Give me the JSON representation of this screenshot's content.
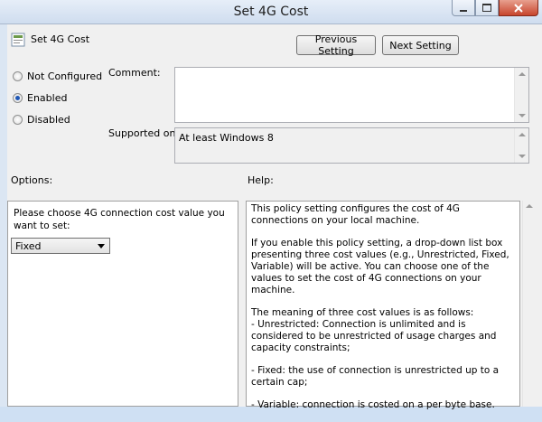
{
  "window": {
    "title": "Set 4G Cost"
  },
  "header": {
    "policy_name": "Set 4G Cost"
  },
  "nav": {
    "previous_label": "Previous Setting",
    "next_label": "Next Setting"
  },
  "state": {
    "options": [
      "Not Configured",
      "Enabled",
      "Disabled"
    ],
    "selected": "Enabled"
  },
  "comment": {
    "label": "Comment:",
    "value": ""
  },
  "supported": {
    "label": "Supported on:",
    "value": "At least Windows 8"
  },
  "options_section": {
    "label": "Options:",
    "prompt": "Please choose 4G connection cost value you want to set:",
    "dropdown_value": "Fixed"
  },
  "help_section": {
    "label": "Help:",
    "paragraphs": [
      "This policy setting configures the cost of 4G connections on your local machine.",
      "If you enable this policy setting, a drop-down list box presenting three cost values (e.g., Unrestricted, Fixed, Variable) will be active. You can choose one of the values to set the cost of 4G connections on your machine.",
      "The meaning of three cost values is as follows:\n- Unrestricted: Connection is unlimited and is considered to be unrestricted of usage charges and capacity constraints;",
      "- Fixed: the use of connection is unrestricted up to a certain cap;",
      "- Variable: connection is costed on a per byte base."
    ]
  },
  "colors": {
    "title_bg": "#dbe6f3",
    "client_bg": "#f0f0f0",
    "close_button": "#c7452c",
    "radio_dot": "#1f57b5"
  }
}
